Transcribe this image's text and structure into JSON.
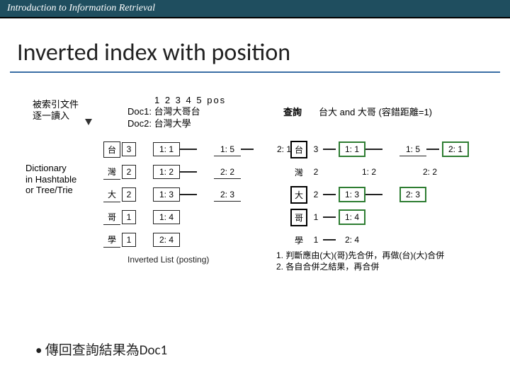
{
  "topbar": {
    "title": "Introduction to Information Retrieval"
  },
  "slide": {
    "title": "Inverted index with position"
  },
  "left_labels": {
    "index_docs": "被索引文件",
    "read_one": "逐一讀入",
    "dict_line1": "Dictionary",
    "dict_line2": "in Hashtable",
    "dict_line3": "or Tree/Trie"
  },
  "docs": {
    "pos_header": "1  2  3  4  5  pos",
    "doc1": "Doc1: 台灣大哥台",
    "doc2": "Doc2: 台灣大學"
  },
  "query": {
    "label": "查詢",
    "text": "台大 and 大哥  (容錯距離=1)"
  },
  "left_table": {
    "rows": [
      {
        "term": "台",
        "df": "3",
        "posts": [
          "1: 1",
          "1: 5",
          "2: 1"
        ]
      },
      {
        "term": "灣",
        "df": "2",
        "posts": [
          "1: 2",
          "2: 2"
        ]
      },
      {
        "term": "大",
        "df": "2",
        "posts": [
          "1: 3",
          "2: 3"
        ]
      },
      {
        "term": "哥",
        "df": "1",
        "posts": [
          "1: 4"
        ]
      },
      {
        "term": "學",
        "df": "1",
        "posts": [
          "2: 4"
        ]
      }
    ]
  },
  "right_table": {
    "rows": [
      {
        "term": "台",
        "df": "3",
        "posts": [
          "1: 1",
          "1: 5",
          "2: 1"
        ]
      },
      {
        "term": "灣",
        "df": "2",
        "posts": [
          "1: 2",
          "2: 2"
        ]
      },
      {
        "term": "大",
        "df": "2",
        "posts": [
          "1: 3",
          "2: 3"
        ]
      },
      {
        "term": "哥",
        "df": "1",
        "posts": [
          "1: 4"
        ]
      },
      {
        "term": "學",
        "df": "1",
        "posts": [
          "2: 4"
        ]
      }
    ]
  },
  "captions": {
    "inverted_list": "Inverted List (posting)"
  },
  "notes": {
    "line1": "1. 判斷應由(大)(哥)先合併，再做(台)(大)合併",
    "line2": "2. 各自合併之結果，再合併"
  },
  "bullet": {
    "text": "傳回查詢結果為Doc1"
  }
}
